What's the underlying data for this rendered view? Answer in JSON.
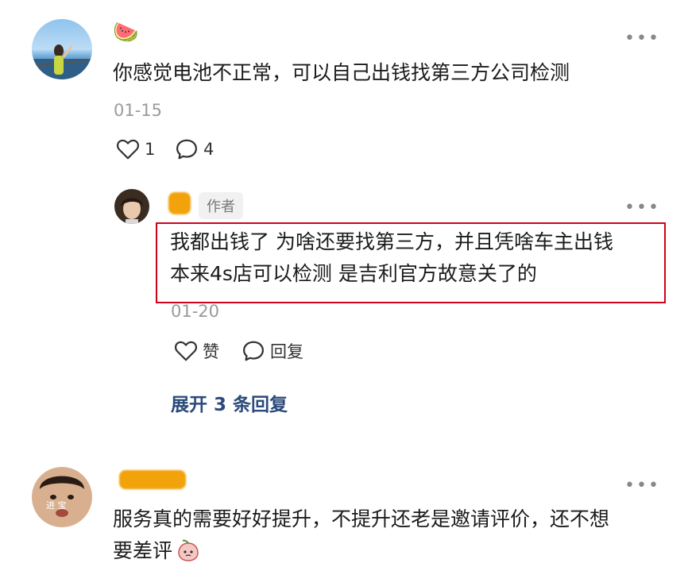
{
  "comment1": {
    "username_emoji": "🍉",
    "text": "你感觉电池不正常，可以自己出钱找第三方公司检测",
    "date": "01-15",
    "likes": "1",
    "replies": "4"
  },
  "reply": {
    "author_badge": "作者",
    "text_line1": "我都出钱了 为啥还要找第三方，并且凭啥车主出钱",
    "text_line2": "本来4s店可以检测 是吉利官方故意关了的",
    "date": "01-20",
    "like_label": "赞",
    "reply_label": "回复",
    "expand_label": "展开 3 条回复"
  },
  "comment2": {
    "text_line1": "服务真的需要好好提升，不提升还老是邀请评价，还不想",
    "text_line2": "要差评",
    "avatar_caption": "进 宝"
  },
  "more_glyph": "•••",
  "colors": {
    "highlight_border": "#d0021b",
    "redaction": "#f2a20a",
    "expand_link": "#2b4a7a"
  }
}
